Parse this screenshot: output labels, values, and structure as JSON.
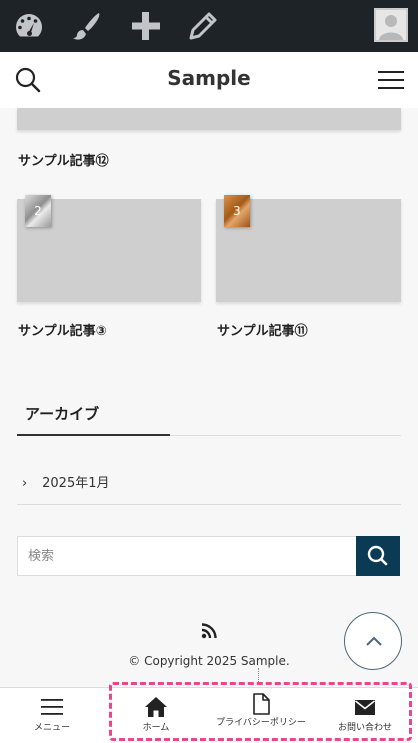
{
  "adminbar": {
    "icons": [
      "dashboard-icon",
      "customize-brush-icon",
      "new-content-plus-icon",
      "edit-pencil-icon",
      "user-avatar-icon"
    ]
  },
  "header": {
    "site_title": "Sample",
    "icons": [
      "search-icon",
      "hamburger-menu-icon"
    ]
  },
  "posts": [
    {
      "title": "サンプル記事⑫",
      "rank": ""
    },
    {
      "title": "サンプル記事③",
      "rank": "2"
    },
    {
      "title": "サンプル記事⑪",
      "rank": "3"
    }
  ],
  "archive_widget": {
    "title": "アーカイブ",
    "items": [
      {
        "label": "2025年1月"
      }
    ]
  },
  "search": {
    "placeholder": "検索"
  },
  "footer": {
    "copyright": "© Copyright 2025 Sample."
  },
  "bottom_nav": {
    "items": [
      {
        "label": "メニュー",
        "icon": "hamburger-menu-icon"
      },
      {
        "label": "ホーム",
        "icon": "home-icon"
      },
      {
        "label": "プライバシーポリシー",
        "icon": "document-icon"
      },
      {
        "label": "お問い合わせ",
        "icon": "envelope-icon"
      }
    ]
  },
  "colors": {
    "adminbar": "#1d2327",
    "search_button": "#0b3b54",
    "highlight": "#e8478b"
  }
}
